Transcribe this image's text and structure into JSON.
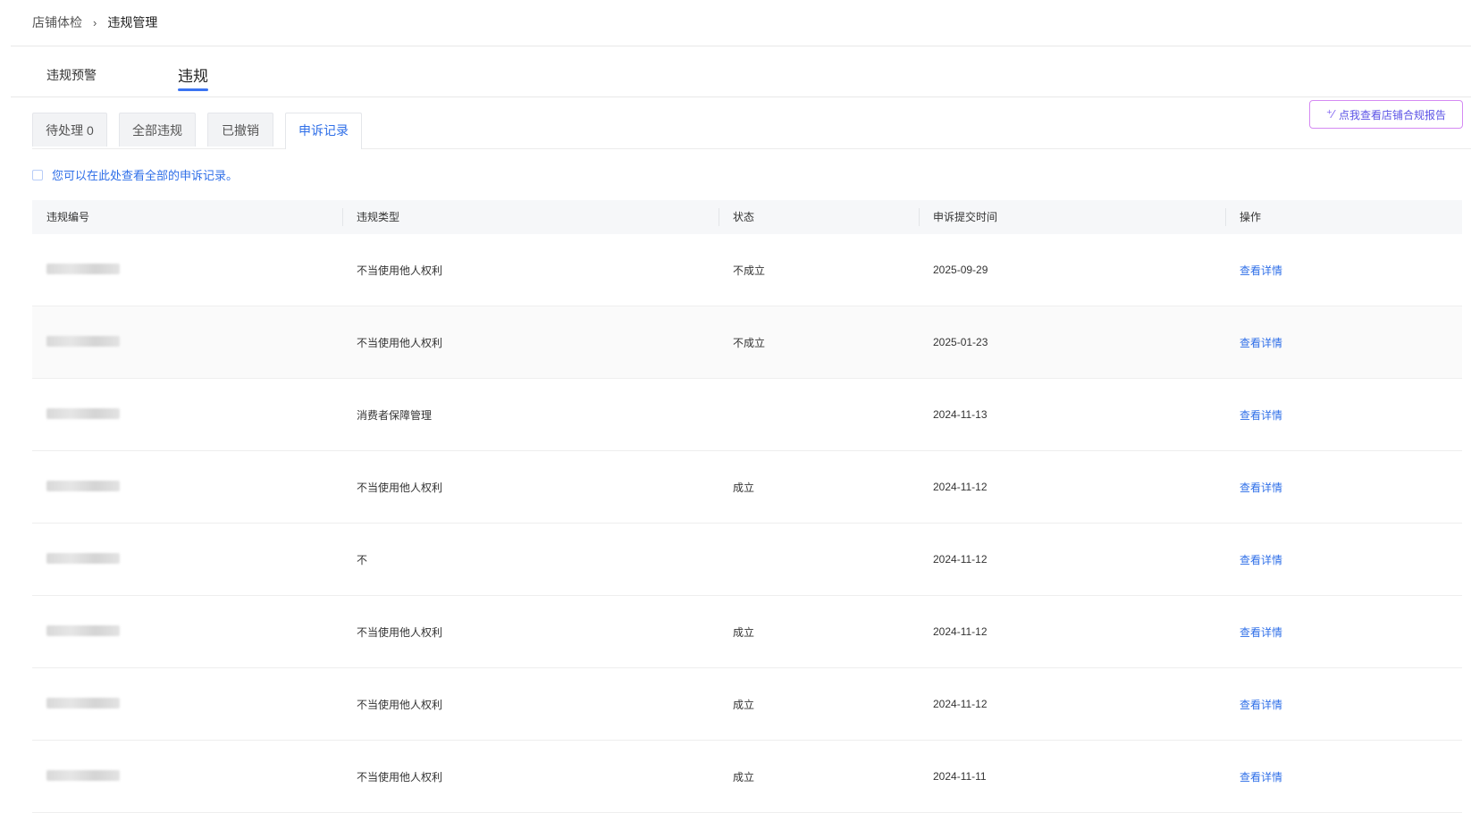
{
  "breadcrumb": {
    "parent": "店铺体检",
    "separator": "›",
    "current": "违规管理"
  },
  "main_tabs": [
    {
      "label": "违规预警"
    },
    {
      "label": "违规"
    }
  ],
  "sub_tabs": [
    {
      "label": "待处理 0"
    },
    {
      "label": "全部违规"
    },
    {
      "label": "已撤销"
    },
    {
      "label": "申诉记录"
    }
  ],
  "report_button": {
    "label": "点我查看店铺合规报告",
    "icon": "sparkle-icon"
  },
  "notice": {
    "text": "您可以在此处查看全部的申诉记录。",
    "icon": "info-icon"
  },
  "table": {
    "columns": [
      "违规编号",
      "违规类型",
      "状态",
      "申诉提交时间",
      "操作"
    ],
    "rows": [
      {
        "id": "",
        "type": "不当使用他人权利",
        "status": "不成立",
        "time": "2025-09-29",
        "action": "查看详情"
      },
      {
        "id": "",
        "type": "不当使用他人权利",
        "status": "不成立",
        "time": "2025-01-23",
        "action": "查看详情"
      },
      {
        "id": "",
        "type": "消费者保障管理",
        "status": "",
        "time": "2024-11-13",
        "action": "查看详情"
      },
      {
        "id": "",
        "type": "不当使用他人权利",
        "status": "成立",
        "time": "2024-11-12",
        "action": "查看详情"
      },
      {
        "id": "",
        "type": "不",
        "status": "",
        "time": "2024-11-12",
        "action": "查看详情"
      },
      {
        "id": "",
        "type": "不当使用他人权利",
        "status": "成立",
        "time": "2024-11-12",
        "action": "查看详情"
      },
      {
        "id": "",
        "type": "不当使用他人权利",
        "status": "成立",
        "time": "2024-11-12",
        "action": "查看详情"
      },
      {
        "id": "",
        "type": "不当使用他人权利",
        "status": "成立",
        "time": "2024-11-11",
        "action": "查看详情"
      }
    ]
  },
  "colors": {
    "accent": "#2f6fe8",
    "tab_underline": "#3b74f2",
    "report_border": "#d58af3"
  }
}
